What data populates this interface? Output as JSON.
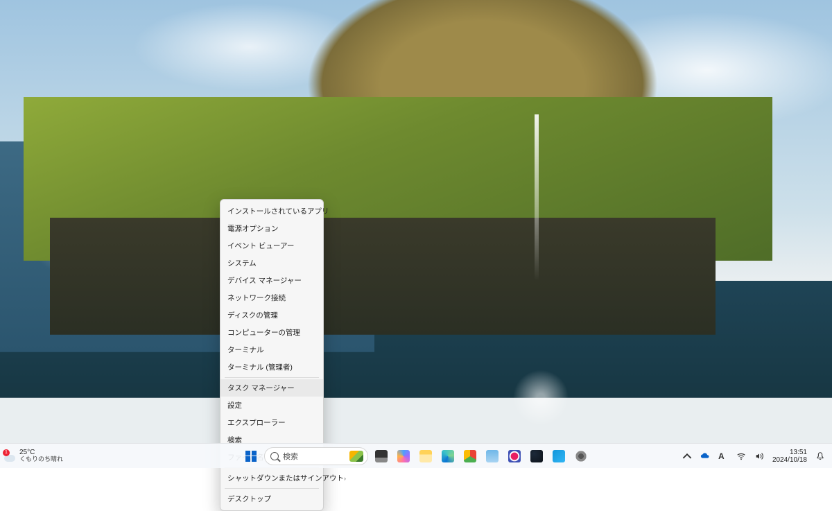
{
  "context_menu": {
    "items": [
      {
        "label": "インストールされているアプリ",
        "hover": false
      },
      {
        "label": "電源オプション",
        "hover": false
      },
      {
        "label": "イベント ビューアー",
        "hover": false
      },
      {
        "label": "システム",
        "hover": false
      },
      {
        "label": "デバイス マネージャー",
        "hover": false
      },
      {
        "label": "ネットワーク接続",
        "hover": false
      },
      {
        "label": "ディスクの管理",
        "hover": false
      },
      {
        "label": "コンピューターの管理",
        "hover": false
      },
      {
        "label": "ターミナル",
        "hover": false
      },
      {
        "label": "ターミナル (管理者)",
        "hover": false
      },
      {
        "label": "タスク マネージャー",
        "hover": true
      },
      {
        "label": "設定",
        "hover": false
      },
      {
        "label": "エクスプローラー",
        "hover": false
      },
      {
        "label": "検索",
        "hover": false
      },
      {
        "label": "ファイル名を指定して実行",
        "hover": false
      },
      {
        "label": "シャットダウンまたはサインアウト",
        "hover": false,
        "submenu": true
      },
      {
        "label": "デスクトップ",
        "hover": false
      }
    ],
    "separators_after_index": [
      9,
      14,
      15
    ]
  },
  "weather": {
    "alert_count": "1",
    "temp": "25°C",
    "condition": "くもりのち晴れ"
  },
  "search": {
    "placeholder": "検索"
  },
  "taskbar": {
    "pinned": [
      {
        "name": "task-view",
        "bg": "linear-gradient(180deg,#333 0 60%,#888 60%)"
      },
      {
        "name": "copilot",
        "bg": "conic-gradient(#4aa0ff,#a06bff,#ff6fae,#ffb347,#4aa0ff)"
      },
      {
        "name": "file-explorer",
        "bg": "linear-gradient(180deg,#ffd257 0 35%,#ffe9a8 35%)"
      },
      {
        "name": "edge",
        "bg": "conic-gradient(from 200deg,#0b76d4,#39c1c9,#7ed492,#0b76d4)"
      },
      {
        "name": "chrome",
        "bg": "conic-gradient(#ea4335 0 33%,#4caf50 33% 66%,#fbbc05 66%)"
      },
      {
        "name": "notepad",
        "bg": "linear-gradient(180deg,#6fb7e8,#a9d4f2)"
      },
      {
        "name": "snipping-tool",
        "bg": "radial-gradient(circle,#e91e63 40%,#fff 45% 55%,#3f51b5 60%)"
      },
      {
        "name": "steam",
        "bg": "radial-gradient(circle at 30% 30%,#1b2838,#0e141b)"
      },
      {
        "name": "microsoft-store",
        "bg": "linear-gradient(135deg,#1296db,#32b6f4)"
      },
      {
        "name": "settings",
        "bg": "radial-gradient(circle,#555 30%,#888 32% 60%,transparent 61%)"
      }
    ]
  },
  "tray": {
    "ime_mode": "A"
  },
  "clock": {
    "time": "13:51",
    "date": "2024/10/18"
  }
}
